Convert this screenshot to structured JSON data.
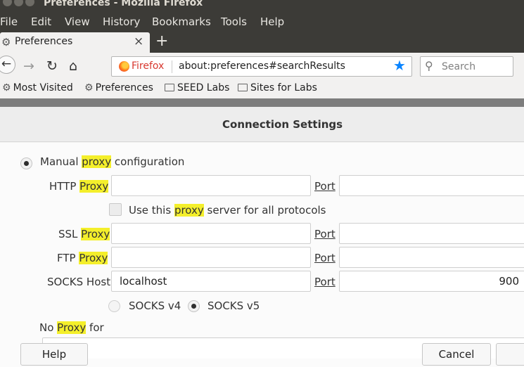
{
  "window": {
    "title": "Preferences - Mozilla Firefox"
  },
  "menu": [
    "File",
    "Edit",
    "View",
    "History",
    "Bookmarks",
    "Tools",
    "Help"
  ],
  "tab": {
    "label": "Preferences",
    "icon": "gear-icon",
    "close_glyph": "×",
    "new_tab_glyph": "+"
  },
  "nav": {
    "identity_label": "Firefox",
    "url": "about:preferences#searchResults",
    "search_placeholder": "Search"
  },
  "bookmarks": [
    {
      "label": "Most Visited",
      "icon": "gear-icon"
    },
    {
      "label": "Preferences",
      "icon": "gear-icon"
    },
    {
      "label": "SEED Labs",
      "icon": "folder-icon"
    },
    {
      "label": "Sites for Labs",
      "icon": "folder-icon"
    }
  ],
  "dialog": {
    "title": "Connection Settings",
    "manual": {
      "pre": "Manual ",
      "hl": "proxy",
      "post": " configuration",
      "selected": true
    },
    "http": {
      "pre": "HTTP ",
      "hl": "Proxy",
      "value": ""
    },
    "use_all": {
      "pre": "Use this ",
      "hl": "proxy",
      "post": " server for all protocols",
      "checked": false
    },
    "ssl": {
      "pre": "SSL ",
      "hl": "Proxy",
      "value": ""
    },
    "ftp": {
      "pre": "FTP ",
      "hl": "Proxy",
      "value": ""
    },
    "socks": {
      "label": "SOCKS Host",
      "value": "localhost"
    },
    "port_label": "Port",
    "ports": {
      "http": "",
      "ssl": "",
      "ftp": "",
      "socks": "900"
    },
    "socks_v4": "SOCKS v4",
    "socks_v5": "SOCKS v5",
    "socks_version_selected": "v5",
    "no_proxy": {
      "pre": "No ",
      "hl": "Proxy",
      "post": " for"
    },
    "help_button": "Help",
    "cancel_button": "Cancel"
  }
}
